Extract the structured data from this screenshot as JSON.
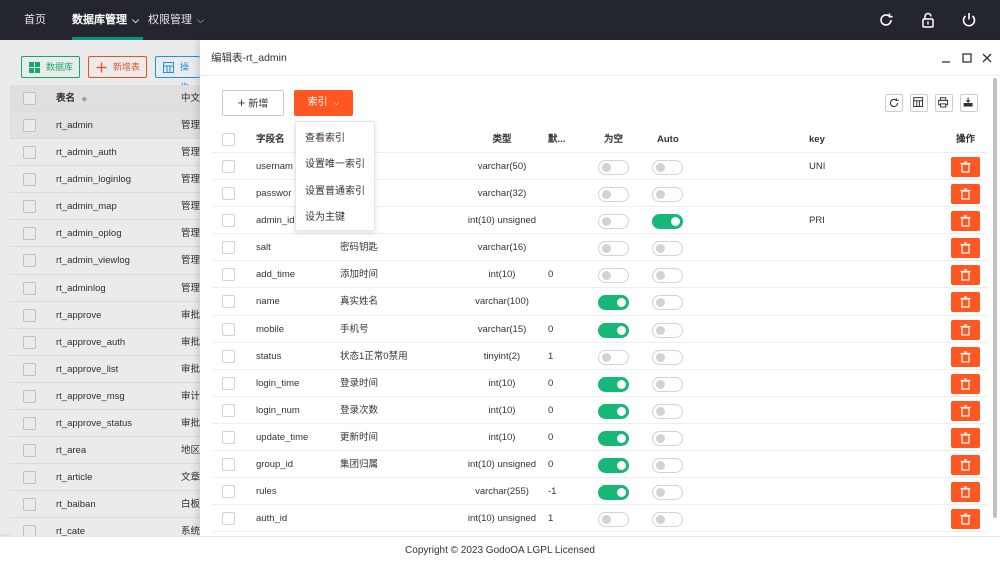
{
  "nav": {
    "items": [
      {
        "label": "首页"
      },
      {
        "label": "数据库管理"
      },
      {
        "label": "权限管理"
      }
    ],
    "accent": "#009688"
  },
  "bg_toolbar": {
    "database_label": "数据库",
    "add_table_label": "新增表",
    "operate_label": "操作"
  },
  "bg_table": {
    "header_name": "表名",
    "header_cn": "中文",
    "rows": [
      {
        "name": "rt_admin",
        "cn": "管理"
      },
      {
        "name": "rt_admin_auth",
        "cn": "管理"
      },
      {
        "name": "rt_admin_loginlog",
        "cn": "管理"
      },
      {
        "name": "rt_admin_map",
        "cn": "管理"
      },
      {
        "name": "rt_admin_oplog",
        "cn": "管理"
      },
      {
        "name": "rt_admin_viewlog",
        "cn": "管理"
      },
      {
        "name": "rt_adminlog",
        "cn": "管理"
      },
      {
        "name": "rt_approve",
        "cn": "审批"
      },
      {
        "name": "rt_approve_auth",
        "cn": "审批"
      },
      {
        "name": "rt_approve_list",
        "cn": "审批"
      },
      {
        "name": "rt_approve_msg",
        "cn": "审计"
      },
      {
        "name": "rt_approve_status",
        "cn": "审批"
      },
      {
        "name": "rt_area",
        "cn": "地区"
      },
      {
        "name": "rt_article",
        "cn": "文章"
      },
      {
        "name": "rt_baiban",
        "cn": "白板"
      },
      {
        "name": "rt_cate",
        "cn": "系统"
      }
    ]
  },
  "modal": {
    "title": "编辑表-rt_admin",
    "add_label": "新增",
    "index_label": "索引",
    "columns": {
      "name": "字段名",
      "type": "类型",
      "default": "默...",
      "nullable": "为空",
      "auto": "Auto",
      "key": "key",
      "op": "操作"
    },
    "dropdown": [
      "查看索引",
      "设置唯一索引",
      "设置普通索引",
      "设为主键"
    ],
    "rows": [
      {
        "name": "usernam",
        "comment": "",
        "type": "varchar(50)",
        "default": "",
        "nullable": false,
        "auto": false,
        "key": "UNI"
      },
      {
        "name": "passwor",
        "comment": "",
        "type": "varchar(32)",
        "default": "",
        "nullable": false,
        "auto": false,
        "key": ""
      },
      {
        "name": "admin_id",
        "comment": "",
        "type": "int(10) unsigned",
        "default": "",
        "nullable": false,
        "auto": true,
        "key": "PRI"
      },
      {
        "name": "salt",
        "comment": "密码钥匙",
        "type": "varchar(16)",
        "default": "",
        "nullable": false,
        "auto": false,
        "key": ""
      },
      {
        "name": "add_time",
        "comment": "添加时间",
        "type": "int(10)",
        "default": "0",
        "nullable": false,
        "auto": false,
        "key": ""
      },
      {
        "name": "name",
        "comment": "真实姓名",
        "type": "varchar(100)",
        "default": "",
        "nullable": true,
        "auto": false,
        "key": ""
      },
      {
        "name": "mobile",
        "comment": "手机号",
        "type": "varchar(15)",
        "default": "0",
        "nullable": true,
        "auto": false,
        "key": ""
      },
      {
        "name": "status",
        "comment": "状态1正常0禁用",
        "type": "tinyint(2)",
        "default": "1",
        "nullable": false,
        "auto": false,
        "key": ""
      },
      {
        "name": "login_time",
        "comment": "登录时间",
        "type": "int(10)",
        "default": "0",
        "nullable": true,
        "auto": false,
        "key": ""
      },
      {
        "name": "login_num",
        "comment": "登录次数",
        "type": "int(10)",
        "default": "0",
        "nullable": true,
        "auto": false,
        "key": ""
      },
      {
        "name": "update_time",
        "comment": "更新时间",
        "type": "int(10)",
        "default": "0",
        "nullable": true,
        "auto": false,
        "key": ""
      },
      {
        "name": "group_id",
        "comment": "集团归属",
        "type": "int(10) unsigned",
        "default": "0",
        "nullable": true,
        "auto": false,
        "key": ""
      },
      {
        "name": "rules",
        "comment": "",
        "type": "varchar(255)",
        "default": "-1",
        "nullable": true,
        "auto": false,
        "key": ""
      },
      {
        "name": "auth_id",
        "comment": "",
        "type": "int(10) unsigned",
        "default": "1",
        "nullable": false,
        "auto": false,
        "key": ""
      }
    ]
  },
  "footer": {
    "text": "Copyright © 2023 GodoOA LGPL Licensed"
  },
  "colors": {
    "danger": "#ff5722",
    "switch_on": "#16b777",
    "topbar": "#23262e"
  }
}
